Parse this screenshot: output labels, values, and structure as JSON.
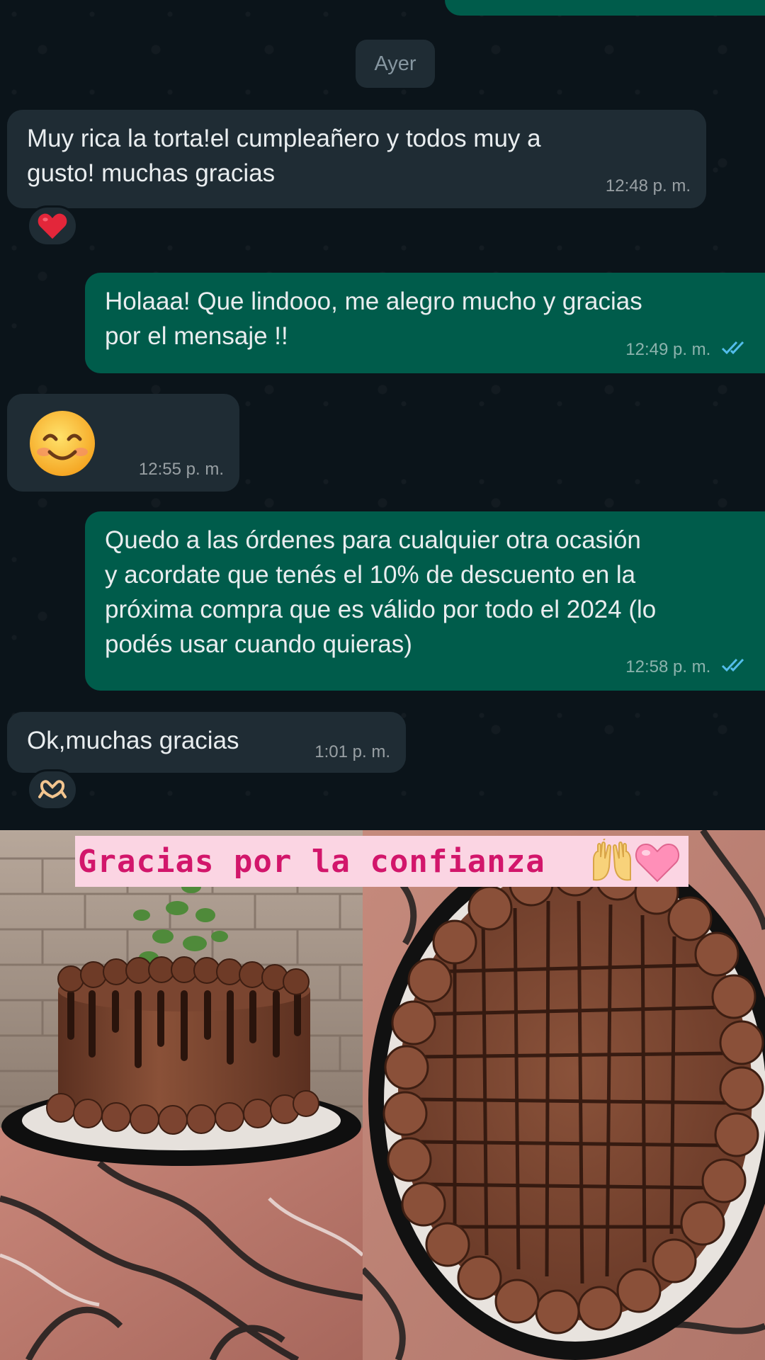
{
  "chat": {
    "date_separator": "Ayer",
    "messages": [
      {
        "direction": "incoming",
        "text": "Muy rica la torta!el cumpleañero y todos muy a\ngusto! muchas gracias",
        "time": "12:48 p. m.",
        "reaction": "heart-emoji"
      },
      {
        "direction": "outgoing",
        "text": "Holaaa! Que lindooo, me alegro mucho y gracias\npor el mensaje !!",
        "time": "12:49 p. m.",
        "status": "read"
      },
      {
        "direction": "incoming",
        "emoji": "smiling-face-emoji",
        "time": "12:55 p. m."
      },
      {
        "direction": "outgoing",
        "text": "Quedo a las órdenes para cualquier otra ocasión\ny acordate que tenés el 10% de descuento en la\npróxima compra que es válido por todo el 2024 (lo\npodés usar cuando quieras)",
        "time": "12:58 p. m.",
        "status": "read"
      },
      {
        "direction": "incoming",
        "text": "Ok,muchas gracias",
        "time": "1:01 p. m.",
        "reaction": "heart-hands-emoji"
      }
    ]
  },
  "collage": {
    "banner_text": "Gracias por la confianza",
    "banner_icons": [
      "raising-hands-emoji",
      "pink-heart-emoji"
    ],
    "photos": [
      "chocolate-drip-cake-side-view",
      "chocolate-cake-top-view"
    ]
  },
  "colors": {
    "chat_background": "#0b141a",
    "incoming_bubble": "#1f2c34",
    "outgoing_bubble": "#005c4b",
    "read_ticks": "#53bdeb",
    "banner_background": "#fbd5e3",
    "banner_text": "#d2166b"
  }
}
